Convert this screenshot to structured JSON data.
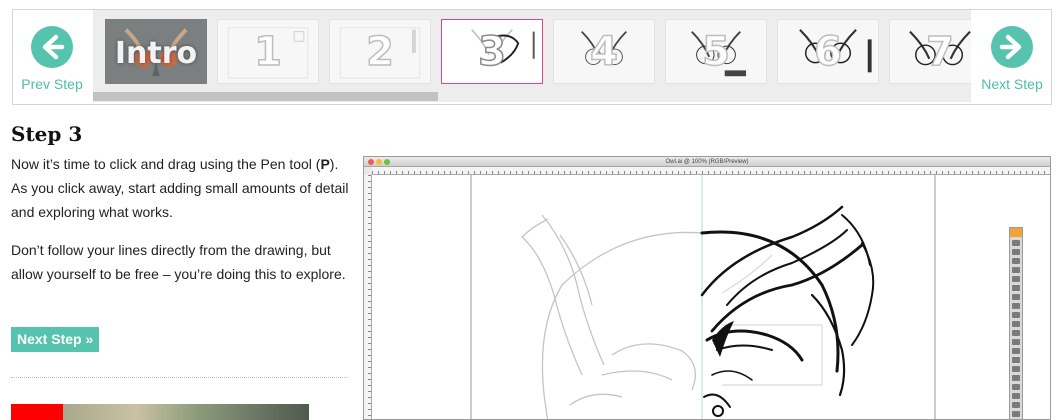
{
  "carousel": {
    "prev_label": "Prev Step",
    "next_label": "Next Step",
    "thumbnails": [
      {
        "label": "Intro",
        "active": false
      },
      {
        "label": "1",
        "active": false
      },
      {
        "label": "2",
        "active": false
      },
      {
        "label": "3",
        "active": true
      },
      {
        "label": "4",
        "active": false
      },
      {
        "label": "5",
        "active": false
      },
      {
        "label": "6",
        "active": false
      },
      {
        "label": "7",
        "active": false
      }
    ],
    "active_color": "#d6449c",
    "accent_color": "#55c3ad"
  },
  "article": {
    "title": "Step 3",
    "p1_before": "Now it’s time to click and drag using the Pen tool (",
    "p1_key": "P",
    "p1_after": "). As you click away, start adding small amounts of detail and exploring what works.",
    "p2": "Don’t follow your lines directly from the drawing, but allow yourself to be free – you’re doing this to explore.",
    "next_button": "Next Step »"
  },
  "screenshot": {
    "window_title": "Owl.ai @ 100% (RGB/Preview)"
  }
}
